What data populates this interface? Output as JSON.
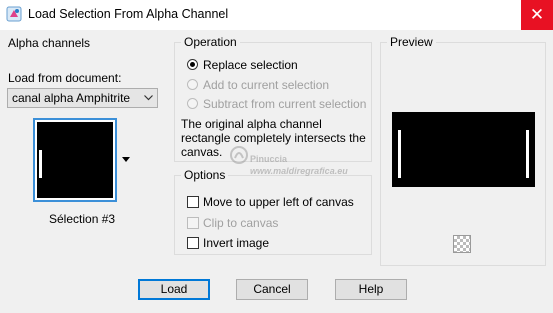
{
  "window": {
    "title": "Load Selection From Alpha Channel",
    "close_label": "✕",
    "app_icon": "psp-app-icon"
  },
  "alpha_channels": {
    "title": "Alpha channels",
    "load_from_label": "Load from document:",
    "document_select": {
      "value": "canal alpha Amphitrite"
    },
    "thumbnail_label": "Sélection #3"
  },
  "operation": {
    "title": "Operation",
    "options": [
      {
        "label": "Replace selection",
        "selected": true,
        "enabled": true
      },
      {
        "label": "Add to current selection",
        "selected": false,
        "enabled": false
      },
      {
        "label": "Subtract from current selection",
        "selected": false,
        "enabled": false
      }
    ],
    "info_text": [
      "The original alpha channel",
      "rectangle completely intersects the",
      "canvas."
    ]
  },
  "options": {
    "title": "Options",
    "items": [
      {
        "label": "Move to upper left of canvas",
        "checked": false,
        "enabled": true
      },
      {
        "label": "Clip to canvas",
        "checked": false,
        "enabled": false
      },
      {
        "label": "Invert image",
        "checked": false,
        "enabled": true
      }
    ]
  },
  "preview": {
    "title": "Preview",
    "background_icon": "transparency-checker-icon"
  },
  "buttons": {
    "load": "Load",
    "cancel": "Cancel",
    "help": "Help"
  },
  "watermark": {
    "line1": "Pinuccia",
    "line2": "www.maldiregrafica.eu"
  },
  "colors": {
    "accent": "#0078d7",
    "close_red": "#e81123",
    "thumb_border": "#3b8fd8",
    "dialog_bg": "#f0f0f0"
  }
}
